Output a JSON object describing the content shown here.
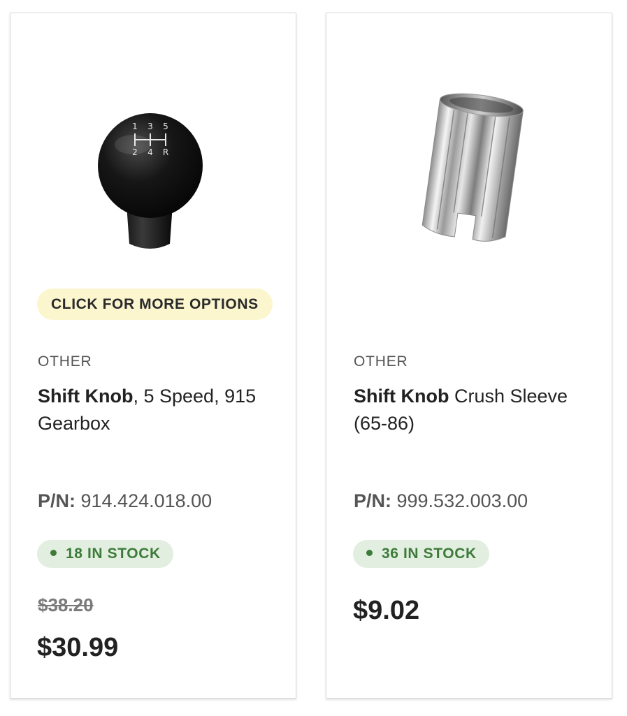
{
  "products": [
    {
      "options_label": "CLICK FOR MORE OPTIONS",
      "category": "OTHER",
      "title_bold": "Shift Knob",
      "title_rest": ", 5 Speed, 915 Gearbox",
      "pn_label": "P/N:",
      "pn_value": " 914.424.018.00",
      "stock": "18 IN STOCK",
      "old_price": "$38.20",
      "price": "$30.99",
      "image": "shift-knob-image",
      "shift_pattern_digits": [
        "1",
        "3",
        "5",
        "2",
        "4",
        "R"
      ]
    },
    {
      "category": "OTHER",
      "title_bold": "Shift Knob",
      "title_rest": " Crush Sleeve (65-86)",
      "pn_label": "P/N:",
      "pn_value": " 999.532.003.00",
      "stock": "36 IN STOCK",
      "price": "$9.02",
      "image": "crush-sleeve-image"
    }
  ],
  "colors": {
    "options_bg": "#fcf6cf",
    "stock_bg": "#e2efe0",
    "stock_text": "#3e7a3a",
    "old_price": "#7a7a7a"
  }
}
